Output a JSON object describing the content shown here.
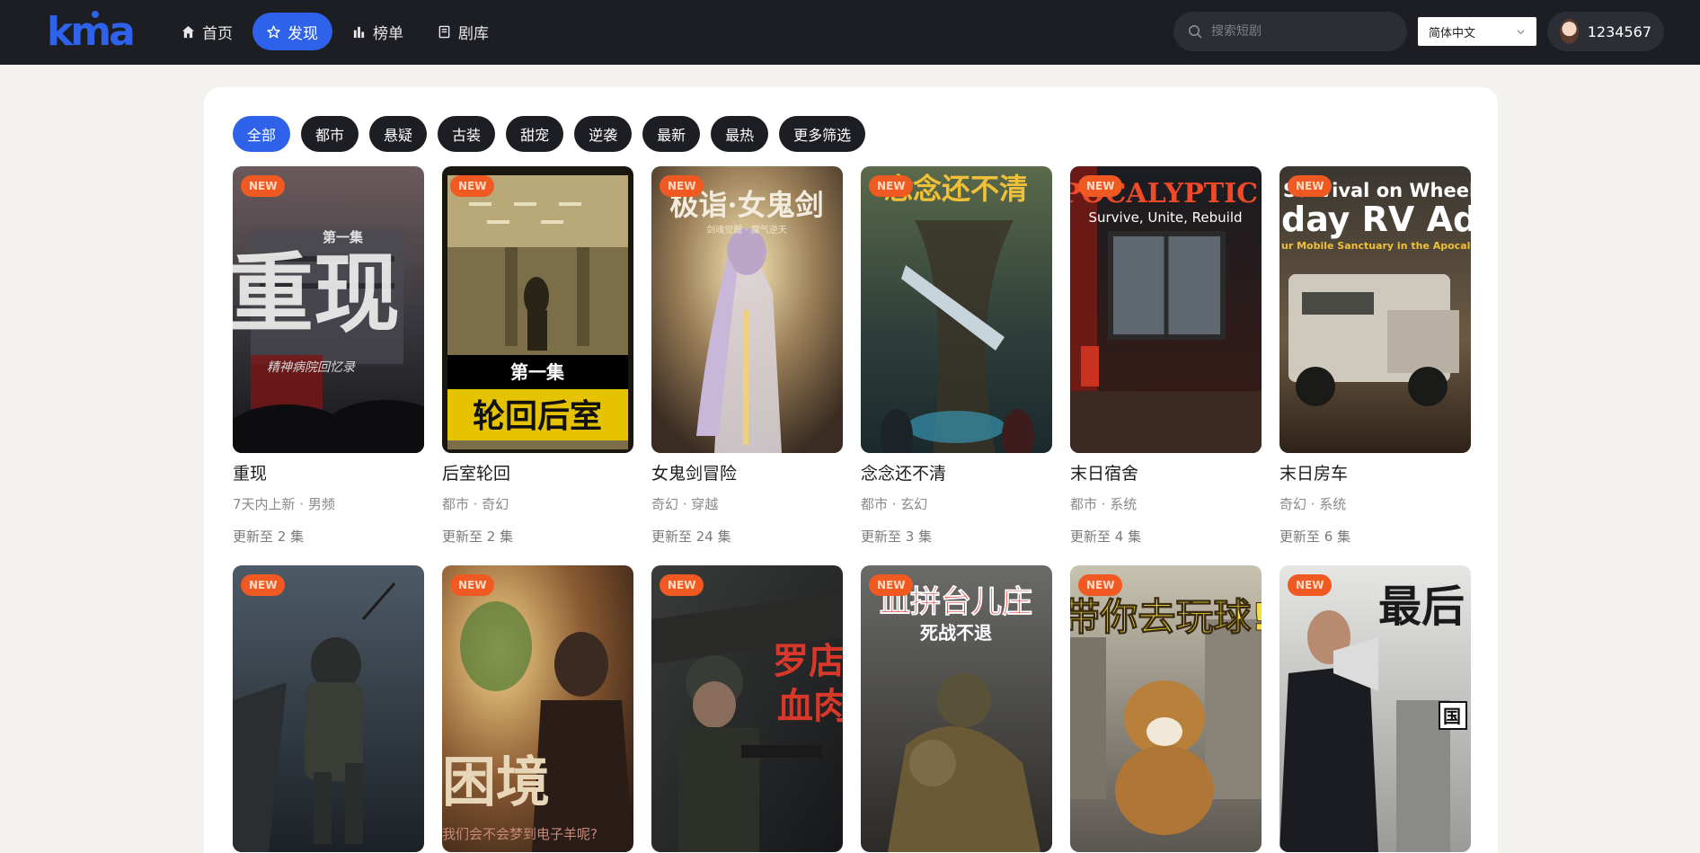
{
  "nav": {
    "logo": "kma",
    "items": [
      {
        "label": "首页",
        "icon": "home-icon"
      },
      {
        "label": "发现",
        "icon": "star-icon",
        "active": true
      },
      {
        "label": "榜单",
        "icon": "chart-icon"
      },
      {
        "label": "剧库",
        "icon": "library-icon"
      }
    ]
  },
  "search": {
    "placeholder": "搜索短剧"
  },
  "language": {
    "selected": "简体中文"
  },
  "user": {
    "name": "1234567"
  },
  "filters": [
    "全部",
    "都市",
    "悬疑",
    "古装",
    "甜宠",
    "逆袭",
    "最新",
    "最热",
    "更多筛选"
  ],
  "badge_label": "NEW",
  "dramas": [
    {
      "title": "重现",
      "tags": "7天内上新 · 男频",
      "episodes": "更新至 2 集",
      "poster_text": "重现",
      "poster_sub": "精神病院回忆录",
      "poster_top": "第一集"
    },
    {
      "title": "后室轮回",
      "tags": "都市 · 奇幻",
      "episodes": "更新至 2 集",
      "poster_text": "轮回后室",
      "poster_sub": "第一集"
    },
    {
      "title": "女鬼剑冒险",
      "tags": "奇幻 · 穿越",
      "episodes": "更新至 24 集",
      "poster_text": "极诣·女鬼剑",
      "poster_sub": "剑魂觉醒 · 魔气逆天"
    },
    {
      "title": "念念还不清",
      "tags": "都市 · 玄幻",
      "episodes": "更新至 3 集",
      "poster_text": "念念还不清"
    },
    {
      "title": "末日宿舍",
      "tags": "都市 · 系统",
      "episodes": "更新至 4 集",
      "poster_text": "APOCALYPTIC D",
      "poster_sub": "Survive, Unite, Rebuild"
    },
    {
      "title": "末日房车",
      "tags": "奇幻 · 系统",
      "episodes": "更新至 6 集",
      "poster_text": "Survival on Wheels:",
      "poster_sub": "day RV Adv",
      "poster_sub2": "ur Mobile Sanctuary in the Apocalyp"
    }
  ],
  "dramas_row2": [
    {
      "poster_text": ""
    },
    {
      "poster_text": "困境",
      "poster_sub": "我们会不会梦到电子羊呢?"
    },
    {
      "poster_text": "罗店",
      "poster_sub": "血肉"
    },
    {
      "poster_text": "血拼台儿庄",
      "poster_sub": "死战不退"
    },
    {
      "poster_text": "带你去玩球!"
    },
    {
      "poster_text": "最后",
      "poster_sub": "国"
    }
  ],
  "colors": {
    "topbar": "#1c1e24",
    "accent": "#2f62ea",
    "badge": "#f05a22",
    "chip": "#1c1e24",
    "background": "#f3f2ee"
  }
}
